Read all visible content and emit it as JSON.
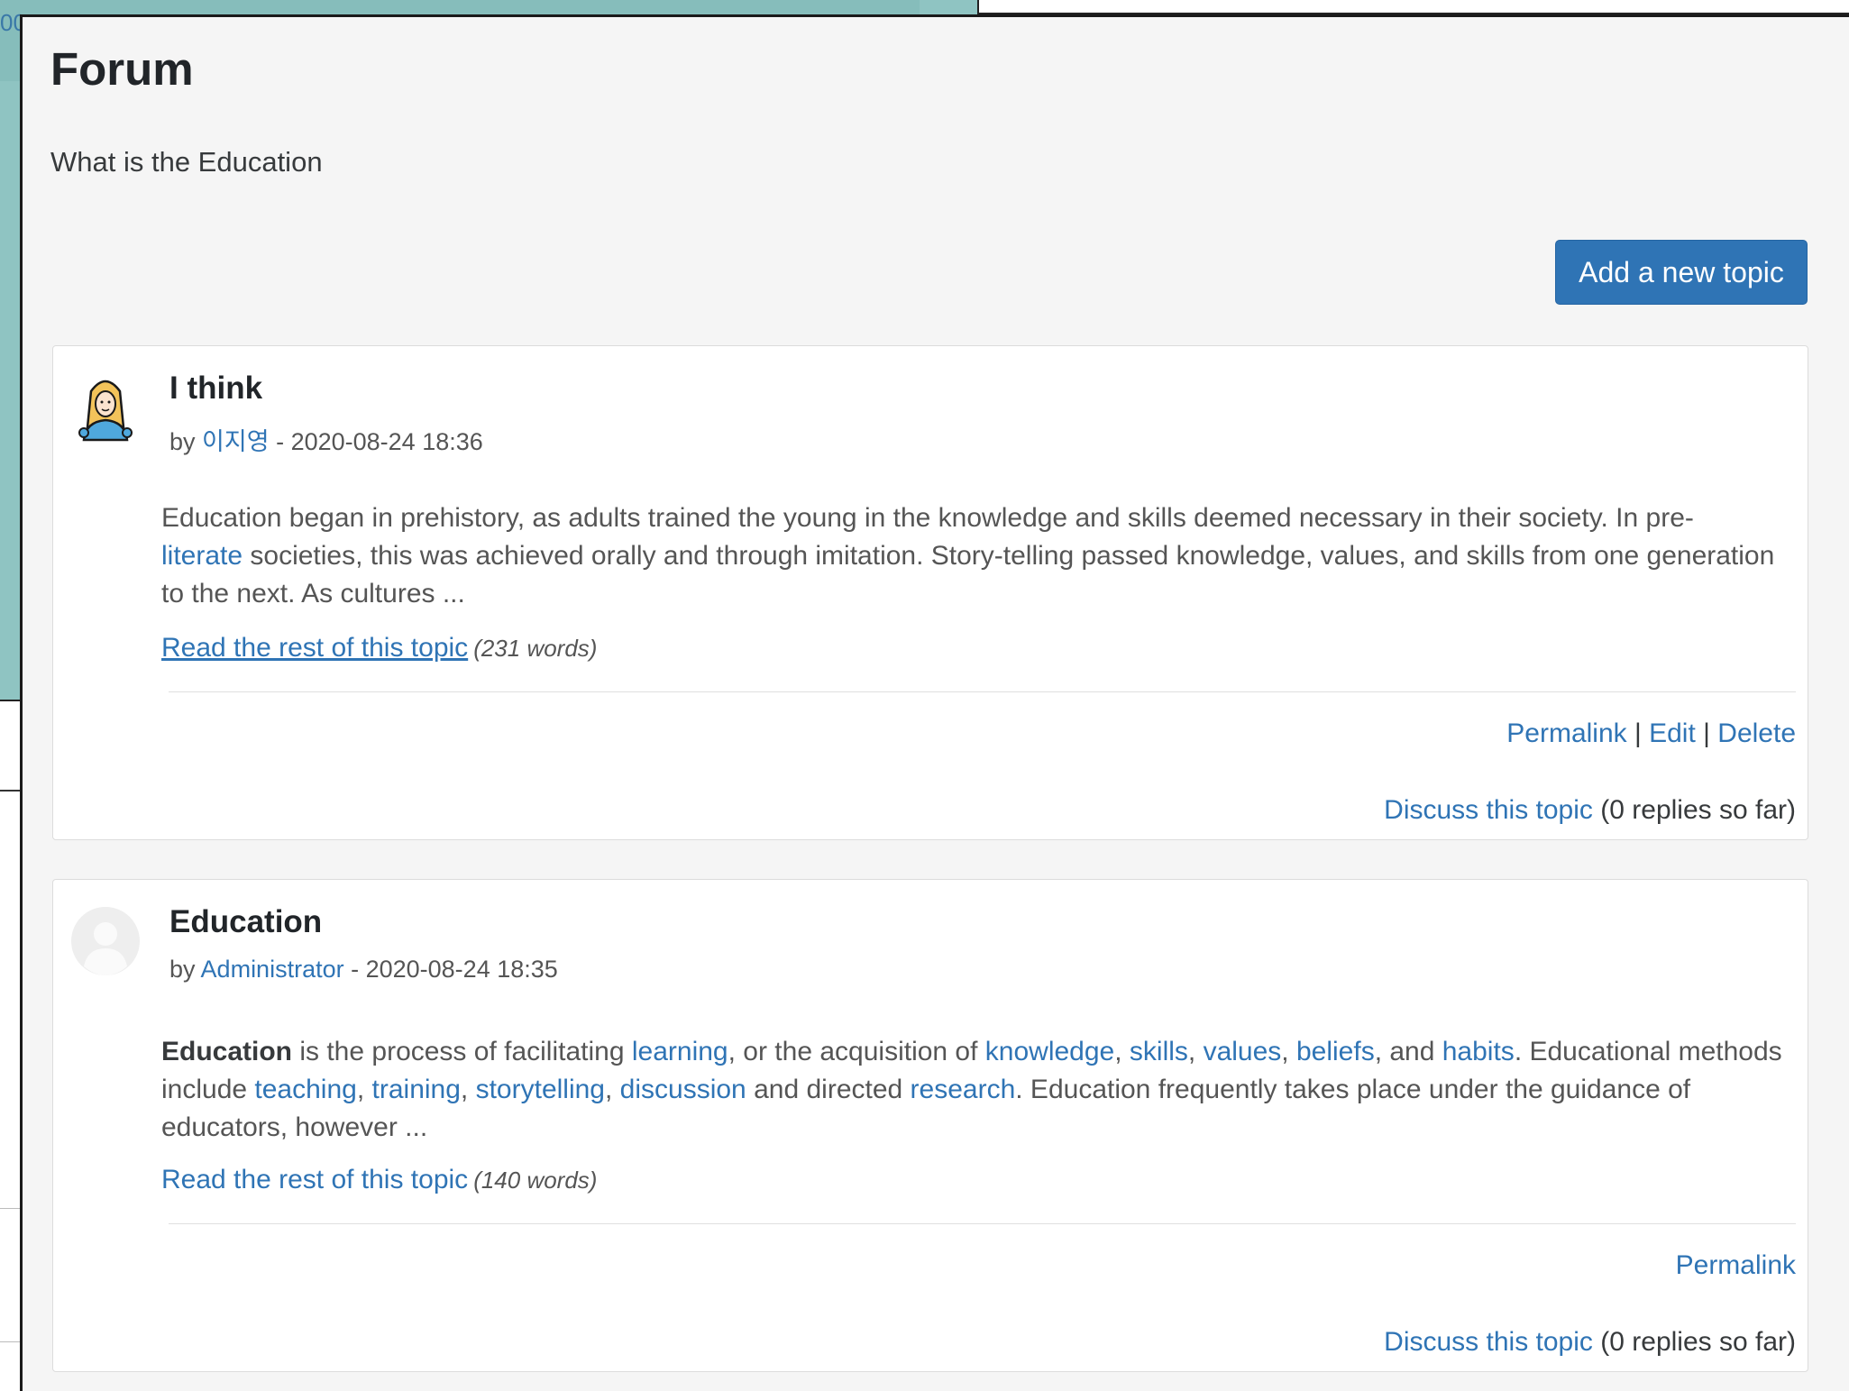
{
  "background": {
    "teal_fragment_text": "00"
  },
  "forum": {
    "title": "Forum",
    "intro": "What is the Education",
    "add_topic_label": "Add a new topic"
  },
  "posts": [
    {
      "subject": "I think",
      "by": "by",
      "author": "이지영",
      "sep": " - ",
      "date": "2020-08-24 18:36",
      "body": {
        "t1": "Education began in prehistory, as adults trained the young in the knowledge and skills deemed necessary in their society. In pre-",
        "l1": "literate",
        "t2": " societies, this was achieved orally and through imitation. Story-telling passed knowledge, values, and skills from one generation to the next. As cultures ..."
      },
      "read_more": "Read the rest of this topic",
      "words": "(231 words)",
      "commands": {
        "permalink": "Permalink",
        "sep": " | ",
        "edit": "Edit",
        "delete": "Delete"
      },
      "discuss": "Discuss this topic",
      "replies": " (0 replies so far)"
    },
    {
      "subject": "Education",
      "by": "by",
      "author": "Administrator",
      "sep": " - ",
      "date": "2020-08-24 18:35",
      "body": {
        "b0": "Education",
        "t0": " is the process of facilitating ",
        "l_learning": "learning",
        "t1": ", or the acquisition of ",
        "l_knowledge": "knowledge",
        "c1": ", ",
        "l_skills": "skills",
        "c2": ", ",
        "l_values": "values",
        "c3": ", ",
        "l_beliefs": "beliefs",
        "t2": ", and ",
        "l_habits": "habits",
        "t3": ". Educational methods include ",
        "l_teaching": "teaching",
        "c4": ", ",
        "l_training": "training",
        "c5": ", ",
        "l_storytelling": "storytelling",
        "c6": ", ",
        "l_discussion": "discussion",
        "t4": " and directed ",
        "l_research": "research",
        "t5": ". Education frequently takes place under the guidance of educators, however ..."
      },
      "read_more": "Read the rest of this topic",
      "words": "(140 words)",
      "commands": {
        "permalink": "Permalink"
      },
      "discuss": "Discuss this topic",
      "replies": " (0 replies so far)"
    }
  ],
  "colors": {
    "link": "#2f74b5",
    "button": "#2f74b5",
    "window_bg": "#f5f5f5",
    "teal_bg": "#8fc4c2"
  }
}
